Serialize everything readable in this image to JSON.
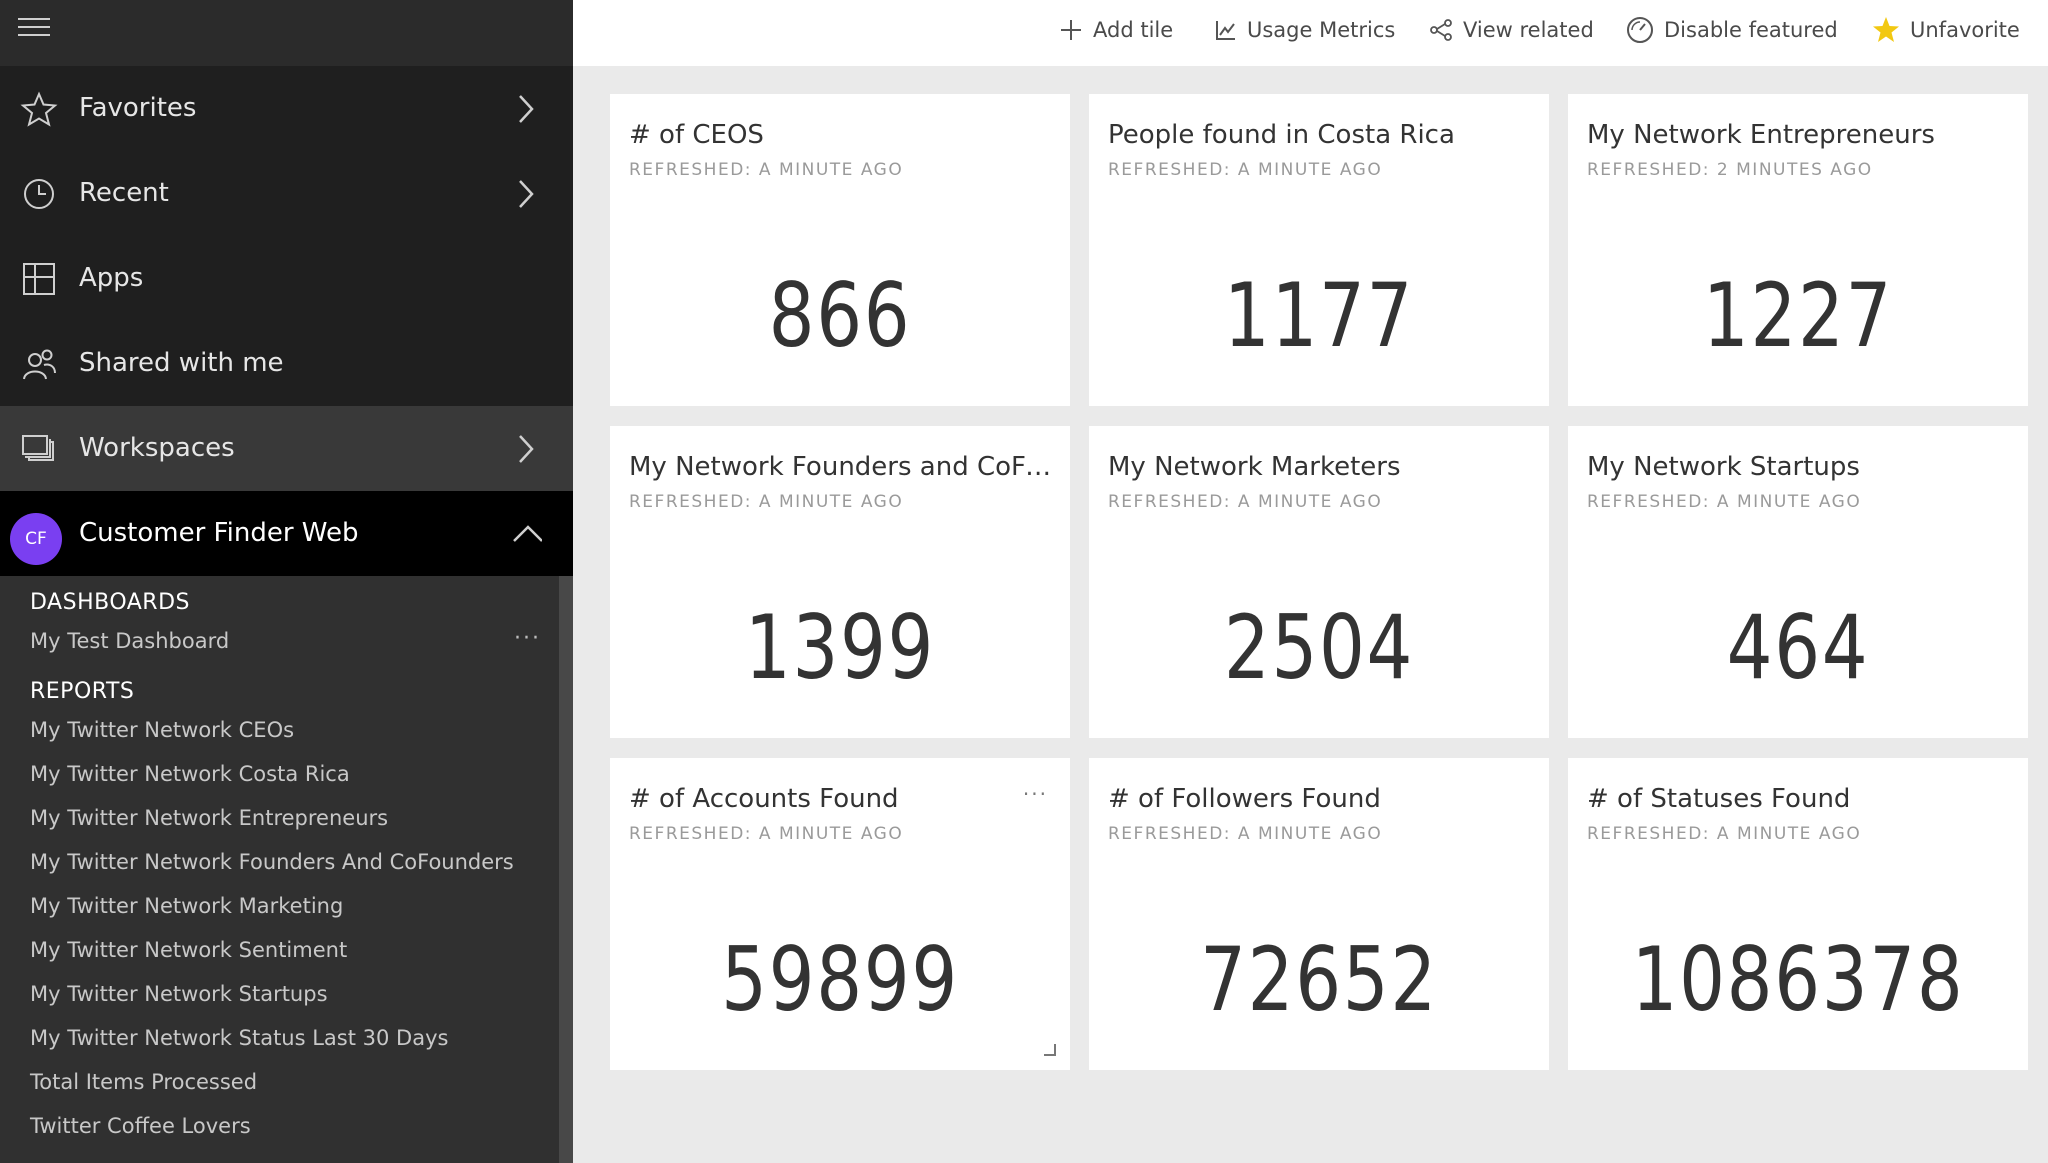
{
  "sidebar": {
    "nav": {
      "favorites": "Favorites",
      "recent": "Recent",
      "apps": "Apps",
      "shared": "Shared with me",
      "workspaces": "Workspaces"
    },
    "workspace": {
      "initials": "CF",
      "name": "Customer Finder Web",
      "avatar_color": "#7a3ff1",
      "dashboards_heading": "DASHBOARDS",
      "dashboards": [
        "My Test Dashboard"
      ],
      "more_glyph": "···",
      "reports_heading": "REPORTS",
      "reports": [
        "My Twitter Network CEOs",
        "My Twitter Network Costa Rica",
        "My Twitter Network Entrepreneurs",
        "My Twitter Network Founders And CoFounders",
        "My Twitter Network Marketing",
        "My Twitter Network Sentiment",
        "My Twitter Network Startups",
        "My Twitter Network Status Last 30 Days",
        "Total Items Processed",
        "Twitter Coffee Lovers"
      ]
    }
  },
  "toolbar": {
    "add_tile": "Add tile",
    "usage_metrics": "Usage Metrics",
    "view_related": "View related",
    "disable_featured": "Disable featured",
    "unfavorite": "Unfavorite",
    "star_color": "#f2c811"
  },
  "tiles": [
    {
      "title": "# of CEOS",
      "refreshed": "REFRESHED: A MINUTE AGO",
      "value": "866"
    },
    {
      "title": "People found in Costa Rica",
      "refreshed": "REFRESHED: A MINUTE AGO",
      "value": "1177"
    },
    {
      "title": "My Network Entrepreneurs",
      "refreshed": "REFRESHED: 2 MINUTES AGO",
      "value": "1227"
    },
    {
      "title": "My Network Founders and CoFo...",
      "refreshed": "REFRESHED: A MINUTE AGO",
      "value": "1399"
    },
    {
      "title": "My Network Marketers",
      "refreshed": "REFRESHED: A MINUTE AGO",
      "value": "2504"
    },
    {
      "title": "My Network Startups",
      "refreshed": "REFRESHED: A MINUTE AGO",
      "value": "464"
    },
    {
      "title": "# of Accounts Found",
      "refreshed": "REFRESHED: A MINUTE AGO",
      "value": "59899",
      "more_glyph": "···"
    },
    {
      "title": "# of Followers Found",
      "refreshed": "REFRESHED: A MINUTE AGO",
      "value": "72652"
    },
    {
      "title": "# of Statuses Found",
      "refreshed": "REFRESHED: A MINUTE AGO",
      "value": "1086378"
    }
  ]
}
